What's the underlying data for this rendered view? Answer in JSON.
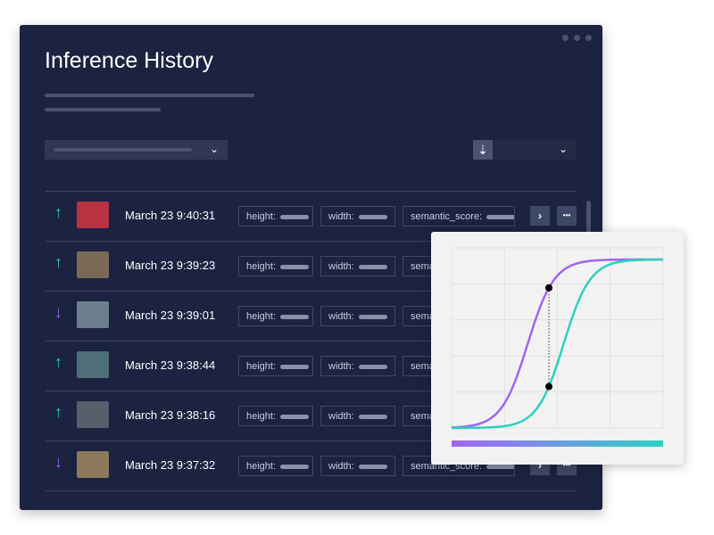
{
  "header": {
    "title": "Inference History"
  },
  "sort": {
    "icon": "sort-descending-icon"
  },
  "rows": [
    {
      "direction": "up",
      "time": "March 23 9:40:31",
      "thumb_color": "#b8323f"
    },
    {
      "direction": "up",
      "time": "March 23 9:39:23",
      "thumb_color": "#7a6a55"
    },
    {
      "direction": "down",
      "time": "March 23 9:39:01",
      "thumb_color": "#6c7f8f"
    },
    {
      "direction": "up",
      "time": "March 23 9:38:44",
      "thumb_color": "#4f6f78"
    },
    {
      "direction": "up",
      "time": "March 23 9:38:16",
      "thumb_color": "#55606a"
    },
    {
      "direction": "down",
      "time": "March 23 9:37:32",
      "thumb_color": "#8d7a5c"
    }
  ],
  "fields": {
    "height": "height:",
    "width": "width:",
    "semantic": "semantic_score:"
  },
  "buttons": {
    "open": "›",
    "more": "•••"
  },
  "colors": {
    "up": "#2fd0c0",
    "down": "#a463f2",
    "panel": "#1b2340"
  },
  "chart_data": {
    "type": "line",
    "series": [
      {
        "color": "#a463f2",
        "shape": "sigmoid",
        "midpoint": 0.36
      },
      {
        "color": "#2fd0c0",
        "shape": "sigmoid",
        "midpoint": 0.53
      }
    ],
    "marker_x": 0.46,
    "grid": true
  }
}
